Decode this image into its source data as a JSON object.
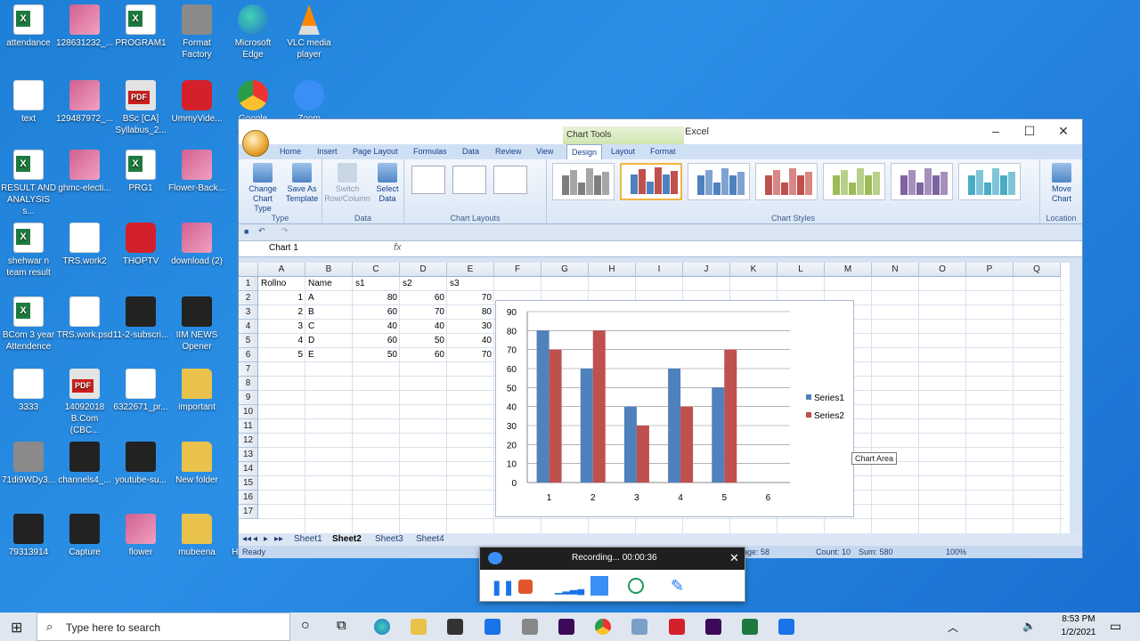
{
  "desktop": {
    "icons": [
      {
        "label": "attendance",
        "icon": "excel"
      },
      {
        "label": "128631232_...",
        "icon": "img"
      },
      {
        "label": "PROGRAM1",
        "icon": "excel"
      },
      {
        "label": "Format Factory",
        "icon": "gray"
      },
      {
        "label": "Microsoft Edge",
        "icon": "edge"
      },
      {
        "label": "VLC media player",
        "icon": "vlc"
      },
      {
        "label": "text",
        "icon": "doc"
      },
      {
        "label": "129487972_...",
        "icon": "img"
      },
      {
        "label": "BSc [CA] Syllabus_2...",
        "icon": "pdf"
      },
      {
        "label": "UmmyVide...",
        "icon": "red"
      },
      {
        "label": "Google Chrome",
        "icon": "chrome"
      },
      {
        "label": "Zoom",
        "icon": "zoom"
      },
      {
        "label": "RESULT AND ANALYSIS s...",
        "icon": "excel"
      },
      {
        "label": "ghmc-electi...",
        "icon": "img"
      },
      {
        "label": "PRG1",
        "icon": "excel"
      },
      {
        "label": "Flower-Back...",
        "icon": "img"
      },
      {
        "label": "shehwar n team result",
        "icon": "excel"
      },
      {
        "label": "TRS.work2",
        "icon": "doc"
      },
      {
        "label": "THOPTV",
        "icon": "red"
      },
      {
        "label": "download (2)",
        "icon": "img"
      },
      {
        "label": "BCom 3 year Attendence",
        "icon": "excel"
      },
      {
        "label": "TRS.work.psd",
        "icon": "doc"
      },
      {
        "label": "11-2-subscri...",
        "icon": "dark"
      },
      {
        "label": "IIM NEWS Opener",
        "icon": "dark"
      },
      {
        "label": "3333",
        "icon": "doc"
      },
      {
        "label": "14092018 B.Com (CBC...",
        "icon": "pdf"
      },
      {
        "label": "6322671_pr...",
        "icon": "doc"
      },
      {
        "label": "important",
        "icon": "folder"
      },
      {
        "label": "71di9WDy3...",
        "icon": "gray"
      },
      {
        "label": "channels4_...",
        "icon": "dark"
      },
      {
        "label": "youtube-su...",
        "icon": "dark"
      },
      {
        "label": "New folder",
        "icon": "folder"
      },
      {
        "label": "79313914",
        "icon": "dark"
      },
      {
        "label": "Capture",
        "icon": "dark"
      },
      {
        "label": "flower",
        "icon": "img"
      },
      {
        "label": "mubeena",
        "icon": "folder"
      },
      {
        "label": "Hi-Z-Client",
        "icon": "gray"
      }
    ]
  },
  "excel": {
    "title": "2336 - Microsoft Excel",
    "context_tab": "Chart Tools",
    "tabs": [
      "Home",
      "Insert",
      "Page Layout",
      "Formulas",
      "Data",
      "Review",
      "View",
      "Design",
      "Layout",
      "Format"
    ],
    "active_tab": "Design",
    "ribbon": {
      "groups": {
        "type": "Type",
        "data": "Data",
        "layouts": "Chart Layouts",
        "styles": "Chart Styles",
        "location": "Location"
      },
      "buttons": {
        "change_type": "Change Chart Type",
        "save_template": "Save As Template",
        "switch": "Switch Row/Column",
        "select_data": "Select Data",
        "move_chart": "Move Chart"
      },
      "style_colors": [
        [
          "#7f7f7f",
          "#a6a6a6"
        ],
        [
          "#4f81bd",
          "#c0504d"
        ],
        [
          "#4f81bd",
          "#7fa3d1"
        ],
        [
          "#c0504d",
          "#d78784"
        ],
        [
          "#9bbb59",
          "#b8cf8a"
        ],
        [
          "#8064a2",
          "#a590bd"
        ],
        [
          "#4bacc6",
          "#7fc5d8"
        ]
      ]
    },
    "name_box": "Chart 1",
    "fx_label": "fx",
    "columns": [
      "A",
      "B",
      "C",
      "D",
      "E",
      "F",
      "G",
      "H",
      "I",
      "J",
      "K",
      "L",
      "M",
      "N",
      "O",
      "P",
      "Q"
    ],
    "rows": [
      "1",
      "2",
      "3",
      "4",
      "5",
      "6",
      "7",
      "8",
      "9",
      "10",
      "11",
      "12",
      "13",
      "14",
      "15",
      "16",
      "17"
    ],
    "table": {
      "headers": [
        "Rollno",
        "Name",
        "s1",
        "s2",
        "s3"
      ],
      "data": [
        [
          "1",
          "A",
          "80",
          "60",
          "70"
        ],
        [
          "2",
          "B",
          "60",
          "70",
          "80"
        ],
        [
          "3",
          "C",
          "40",
          "40",
          "30"
        ],
        [
          "4",
          "D",
          "60",
          "50",
          "40"
        ],
        [
          "5",
          "E",
          "50",
          "60",
          "70"
        ]
      ]
    },
    "sheets": [
      "Sheet1",
      "Sheet2",
      "Sheet3",
      "Sheet4"
    ],
    "active_sheet": "Sheet2",
    "status": {
      "ready": "Ready",
      "average": "age: 58",
      "count": "Count: 10",
      "sum": "Sum: 580",
      "zoom": "100%"
    },
    "tooltip": "Chart Area"
  },
  "chart_data": {
    "type": "bar",
    "categories": [
      "1",
      "2",
      "3",
      "4",
      "5",
      "6"
    ],
    "series": [
      {
        "name": "Series1",
        "values": [
          80,
          60,
          40,
          60,
          50,
          null
        ],
        "color": "#4f81bd"
      },
      {
        "name": "Series2",
        "values": [
          70,
          80,
          30,
          40,
          70,
          null
        ],
        "color": "#c0504d"
      }
    ],
    "ylim": [
      0,
      90
    ],
    "yticks": [
      "0",
      "10",
      "20",
      "30",
      "40",
      "50",
      "60",
      "70",
      "80",
      "90"
    ],
    "grid": true,
    "legend": "right"
  },
  "recorder": {
    "status": "Recording... 00:00:36"
  },
  "taskbar": {
    "search_placeholder": "Type here to search",
    "time": "8:53 PM",
    "date": "1/2/2021"
  }
}
